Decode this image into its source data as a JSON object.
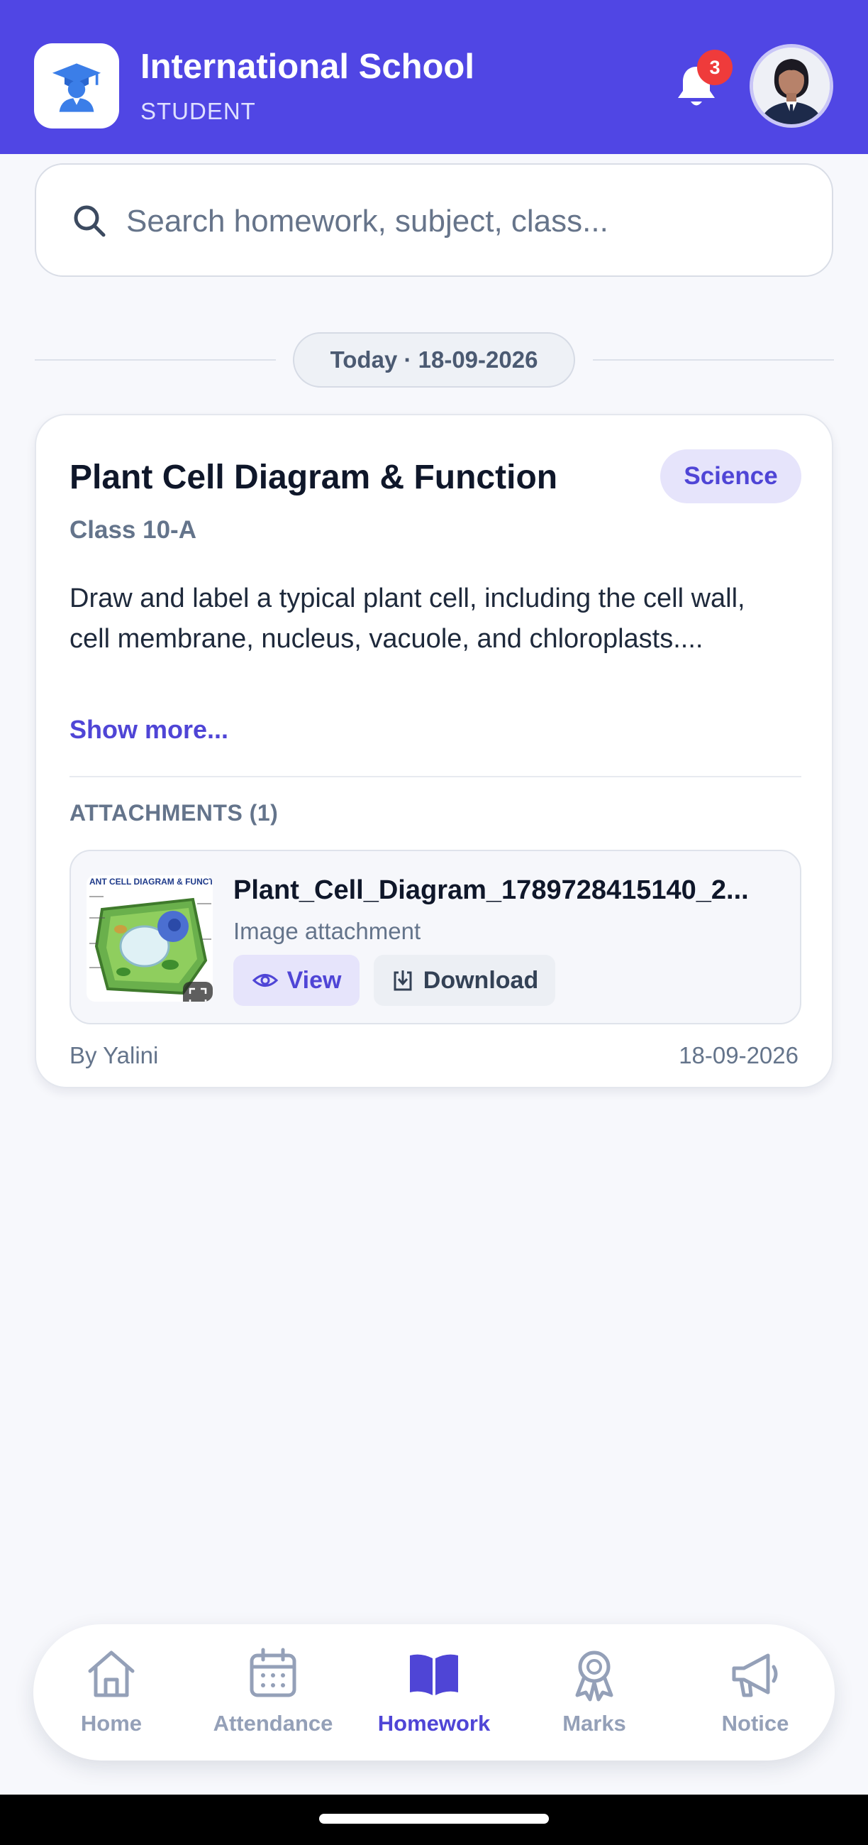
{
  "header": {
    "school_name": "International School",
    "role": "STUDENT",
    "notification_count": "3",
    "brand_color": "#5046e4",
    "logo_icon": "graduate-icon",
    "bell_icon": "bell-icon"
  },
  "search": {
    "placeholder": "Search homework, subject, class..."
  },
  "date_group": {
    "label": "Today · 18-09-2026"
  },
  "homework": {
    "title": "Plant Cell Diagram & Function",
    "subject": "Science",
    "class": "Class 10-A",
    "description": "Draw and label a typical plant cell, including the cell wall, cell membrane, nucleus, vacuole, and chloroplasts....",
    "show_more": "Show more...",
    "attachments_heading": "ATTACHMENTS (1)",
    "attachment": {
      "file_name": "Plant_Cell_Diagram_1789728415140_2...",
      "file_type": "Image attachment",
      "thumbnail_caption": "ANT CELL DIAGRAM & FUNCTI",
      "view_label": "View",
      "download_label": "Download"
    },
    "author": "By Yalini",
    "date": "18-09-2026"
  },
  "nav": {
    "items": [
      {
        "label": "Home",
        "icon": "home-icon"
      },
      {
        "label": "Attendance",
        "icon": "calendar-icon"
      },
      {
        "label": "Homework",
        "icon": "book-icon",
        "active": true
      },
      {
        "label": "Marks",
        "icon": "award-icon"
      },
      {
        "label": "Notice",
        "icon": "megaphone-icon"
      }
    ]
  }
}
